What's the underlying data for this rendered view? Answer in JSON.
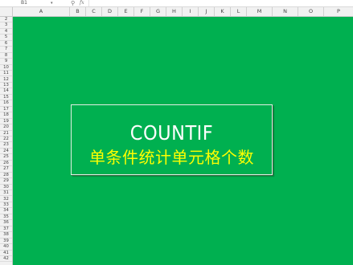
{
  "formula_bar": {
    "name_box": "B1",
    "dropdown": "▾",
    "zoom_icon": "⚲",
    "fx_label": "fx",
    "formula": ""
  },
  "columns": [
    "A",
    "B",
    "C",
    "D",
    "E",
    "F",
    "G",
    "H",
    "I",
    "J",
    "K",
    "L",
    "M",
    "N",
    "O",
    "P"
  ],
  "rows": [
    "2",
    "3",
    "4",
    "5",
    "6",
    "7",
    "8",
    "9",
    "10",
    "11",
    "12",
    "13",
    "14",
    "15",
    "16",
    "17",
    "18",
    "19",
    "20",
    "21",
    "22",
    "23",
    "24",
    "25",
    "26",
    "27",
    "28",
    "29",
    "30",
    "31",
    "32",
    "33",
    "34",
    "35",
    "36",
    "37",
    "38",
    "39",
    "40",
    "41",
    "42"
  ],
  "title_box": {
    "main": "COUNTIF",
    "sub": "单条件统计单元格个数"
  },
  "colors": {
    "background": "#00b050",
    "title_text": "#ffffff",
    "subtitle_text": "#ffff00"
  }
}
